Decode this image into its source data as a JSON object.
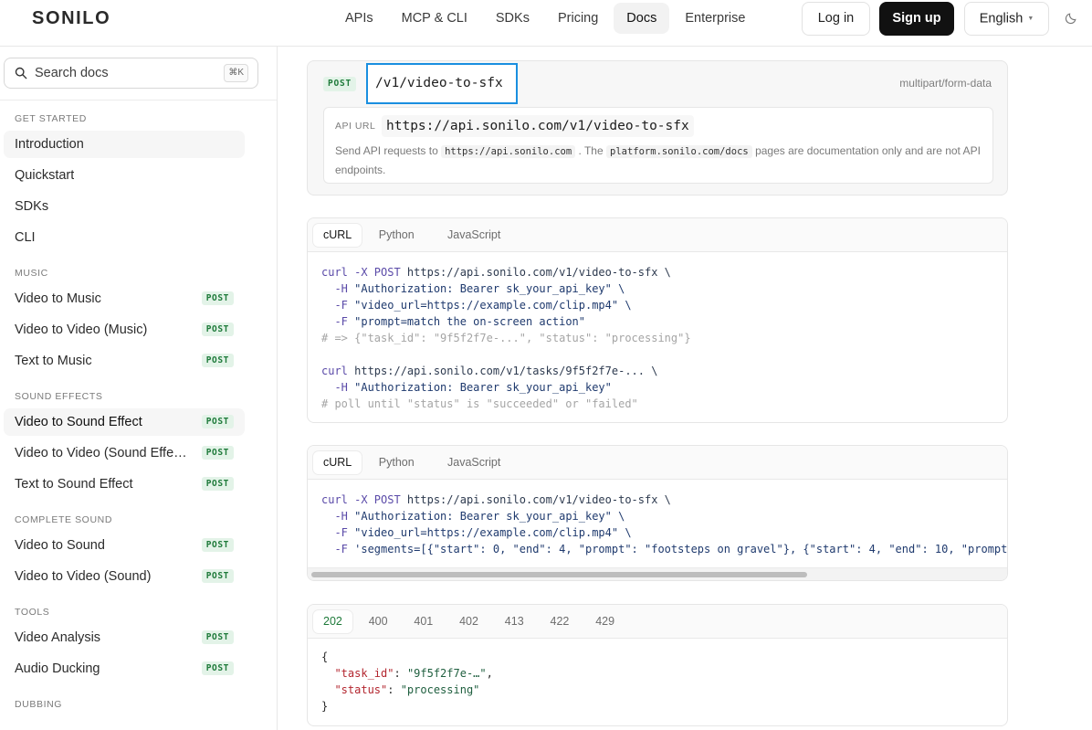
{
  "brand": {
    "logo": "SONILO"
  },
  "nav": {
    "links": [
      "APIs",
      "MCP & CLI",
      "SDKs",
      "Pricing",
      "Docs",
      "Enterprise"
    ],
    "active": "Docs",
    "login": "Log in",
    "signup": "Sign up",
    "language": "English"
  },
  "sidebar": {
    "search_placeholder": "Search docs",
    "search_shortcut": "⌘K",
    "groups": [
      {
        "title": "GET STARTED",
        "items": [
          {
            "label": "Introduction"
          },
          {
            "label": "Quickstart"
          },
          {
            "label": "SDKs"
          },
          {
            "label": "CLI"
          }
        ]
      },
      {
        "title": "MUSIC",
        "items": [
          {
            "label": "Video to Music",
            "badge": "POST"
          },
          {
            "label": "Video to Video (Music)",
            "badge": "POST"
          },
          {
            "label": "Text to Music",
            "badge": "POST"
          }
        ]
      },
      {
        "title": "SOUND EFFECTS",
        "items": [
          {
            "label": "Video to Sound Effect",
            "badge": "POST"
          },
          {
            "label": "Video to Video (Sound Effe…",
            "badge": "POST"
          },
          {
            "label": "Text to Sound Effect",
            "badge": "POST"
          }
        ]
      },
      {
        "title": "COMPLETE SOUND",
        "items": [
          {
            "label": "Video to Sound",
            "badge": "POST"
          },
          {
            "label": "Video to Video (Sound)",
            "badge": "POST"
          }
        ]
      },
      {
        "title": "TOOLS",
        "items": [
          {
            "label": "Video Analysis",
            "badge": "POST"
          },
          {
            "label": "Audio Ducking",
            "badge": "POST"
          }
        ]
      },
      {
        "title": "DUBBING",
        "items": []
      }
    ]
  },
  "endpoint": {
    "method": "POST",
    "path": "/v1/video-to-sfx",
    "content_type": "multipart/form-data",
    "api_url_label": "API URL",
    "api_url": "https://api.sonilo.com/v1/video-to-sfx",
    "note_prefix": "Send API requests to",
    "note_host": "https://api.sonilo.com",
    "note_mid": ". The",
    "note_docs": "platform.sonilo.com/docs",
    "note_suffix": "pages are documentation only and are not API endpoints."
  },
  "code_tabs": [
    "cURL",
    "Python",
    "JavaScript"
  ],
  "code1": {
    "lines": [
      [
        [
          "kw",
          "curl -X POST "
        ],
        [
          "url",
          "https://api.sonilo.com/v1/video-to-sfx \\"
        ]
      ],
      [
        [
          "kw",
          "  -H "
        ],
        [
          "str",
          "\"Authorization: Bearer sk_your_api_key\" \\"
        ]
      ],
      [
        [
          "kw",
          "  -F "
        ],
        [
          "str",
          "\"video_url=https://example.com/clip.mp4\" \\"
        ]
      ],
      [
        [
          "kw",
          "  -F "
        ],
        [
          "str",
          "\"prompt=match the on-screen action\""
        ]
      ],
      [
        [
          "cmt",
          "# => {\"task_id\": \"9f5f2f7e-...\", \"status\": \"processing\"}"
        ]
      ],
      [
        [
          "plain",
          ""
        ]
      ],
      [
        [
          "kw",
          "curl "
        ],
        [
          "url",
          "https://api.sonilo.com/v1/tasks/9f5f2f7e-... \\"
        ]
      ],
      [
        [
          "kw",
          "  -H "
        ],
        [
          "str",
          "\"Authorization: Bearer sk_your_api_key\""
        ]
      ],
      [
        [
          "cmt",
          "# poll until \"status\" is \"succeeded\" or \"failed\""
        ]
      ]
    ]
  },
  "code2": {
    "lines": [
      [
        [
          "kw",
          "curl -X POST "
        ],
        [
          "url",
          "https://api.sonilo.com/v1/video-to-sfx \\"
        ]
      ],
      [
        [
          "kw",
          "  -H "
        ],
        [
          "str",
          "\"Authorization: Bearer sk_your_api_key\" \\"
        ]
      ],
      [
        [
          "kw",
          "  -F "
        ],
        [
          "str",
          "\"video_url=https://example.com/clip.mp4\" \\"
        ]
      ],
      [
        [
          "kw",
          "  -F "
        ],
        [
          "str",
          "'segments=[{\"start\": 0, \"end\": 4, \"prompt\": \"footsteps on gravel\"}, {\"start\": 4, \"end\": 10, \"prompt"
        ]
      ]
    ]
  },
  "response": {
    "tabs": [
      "202",
      "400",
      "401",
      "402",
      "413",
      "422",
      "429"
    ],
    "active": "202",
    "json": [
      [
        [
          "plain",
          "{"
        ]
      ],
      [
        [
          "plain",
          "  "
        ],
        [
          "key",
          "\"task_id\""
        ],
        [
          "plain",
          ": "
        ],
        [
          "jstr",
          "\"9f5f2f7e-…\""
        ],
        [
          "plain",
          ","
        ]
      ],
      [
        [
          "plain",
          "  "
        ],
        [
          "key",
          "\"status\""
        ],
        [
          "plain",
          ": "
        ],
        [
          "jstr",
          "\"processing\""
        ]
      ],
      [
        [
          "plain",
          "}"
        ]
      ]
    ]
  },
  "colors": {
    "accent_focus": "#1a8fe0",
    "post_badge_text": "#1e7a3a",
    "post_badge_bg": "#e3f3e8"
  }
}
